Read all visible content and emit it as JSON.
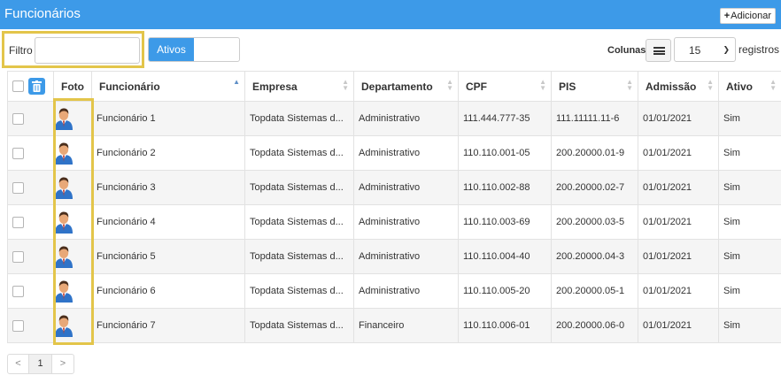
{
  "header": {
    "title": "Funcionários",
    "add_label": "Adicionar"
  },
  "filter": {
    "label": "Filtro",
    "value": "",
    "placeholder": ""
  },
  "status_toggle": {
    "on_label": "Ativos",
    "off_label": ""
  },
  "columns_label": "Colunas:",
  "page_size": {
    "value": "15",
    "suffix": "registros"
  },
  "table": {
    "headers": [
      "Foto",
      "Funcionário",
      "Empresa",
      "Departamento",
      "CPF",
      "PIS",
      "Admissão",
      "Ativo"
    ],
    "rows": [
      [
        "Funcionário 1",
        "Topdata Sistemas d...",
        "Administrativo",
        "111.444.777-35",
        "111.11111.11-6",
        "01/01/2021",
        "Sim"
      ],
      [
        "Funcionário 2",
        "Topdata Sistemas d...",
        "Administrativo",
        "110.110.001-05",
        "200.20000.01-9",
        "01/01/2021",
        "Sim"
      ],
      [
        "Funcionário 3",
        "Topdata Sistemas d...",
        "Administrativo",
        "110.110.002-88",
        "200.20000.02-7",
        "01/01/2021",
        "Sim"
      ],
      [
        "Funcionário 4",
        "Topdata Sistemas d...",
        "Administrativo",
        "110.110.003-69",
        "200.20000.03-5",
        "01/01/2021",
        "Sim"
      ],
      [
        "Funcionário 5",
        "Topdata Sistemas d...",
        "Administrativo",
        "110.110.004-40",
        "200.20000.04-3",
        "01/01/2021",
        "Sim"
      ],
      [
        "Funcionário 6",
        "Topdata Sistemas d...",
        "Administrativo",
        "110.110.005-20",
        "200.20000.05-1",
        "01/01/2021",
        "Sim"
      ],
      [
        "Funcionário 7",
        "Topdata Sistemas d...",
        "Financeiro",
        "110.110.006-01",
        "200.20000.06-0",
        "01/01/2021",
        "Sim"
      ]
    ]
  },
  "pagination": {
    "prev": "<",
    "current": "1",
    "next": ">"
  },
  "icons": {
    "add": "plus-icon",
    "delete": "trash-icon",
    "columns": "list-icon",
    "avatar": "user-avatar-icon"
  },
  "colors": {
    "accent": "#3d9ae8",
    "highlight": "#e3c54a"
  }
}
